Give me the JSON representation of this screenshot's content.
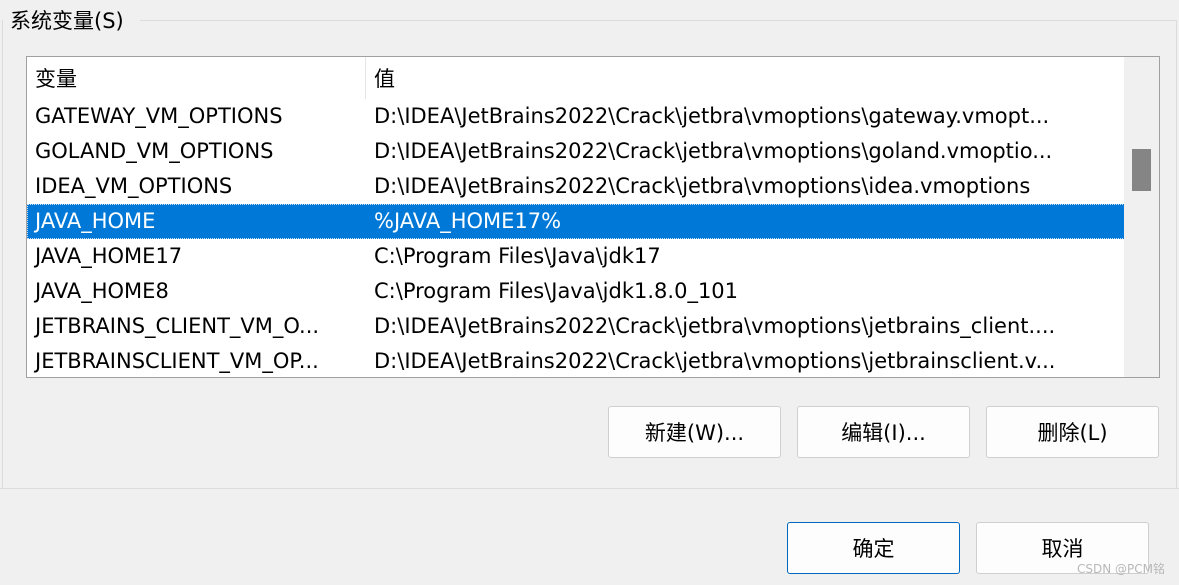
{
  "group": {
    "title": "系统变量(S)"
  },
  "table": {
    "headers": {
      "name": "变量",
      "value": "值"
    },
    "rows": [
      {
        "name": "GATEWAY_VM_OPTIONS",
        "value": "D:\\IDEA\\JetBrains2022\\Crack\\jetbra\\vmoptions\\gateway.vmopt..."
      },
      {
        "name": "GOLAND_VM_OPTIONS",
        "value": "D:\\IDEA\\JetBrains2022\\Crack\\jetbra\\vmoptions\\goland.vmoptio..."
      },
      {
        "name": "IDEA_VM_OPTIONS",
        "value": "D:\\IDEA\\JetBrains2022\\Crack\\jetbra\\vmoptions\\idea.vmoptions"
      },
      {
        "name": "JAVA_HOME",
        "value": "%JAVA_HOME17%"
      },
      {
        "name": "JAVA_HOME17",
        "value": "C:\\Program Files\\Java\\jdk17"
      },
      {
        "name": "JAVA_HOME8",
        "value": "C:\\Program Files\\Java\\jdk1.8.0_101"
      },
      {
        "name": "JETBRAINS_CLIENT_VM_O...",
        "value": "D:\\IDEA\\JetBrains2022\\Crack\\jetbra\\vmoptions\\jetbrains_client...."
      },
      {
        "name": "JETBRAINSCLIENT_VM_OP...",
        "value": "D:\\IDEA\\JetBrains2022\\Crack\\jetbra\\vmoptions\\jetbrainsclient.v..."
      }
    ],
    "selected_row": "JAVA_HOME"
  },
  "buttons": {
    "new": "新建(W)...",
    "edit": "编辑(I)...",
    "delete": "删除(L)",
    "ok": "确定",
    "cancel": "取消"
  },
  "watermark": "CSDN @PCM铭",
  "colors": {
    "selection": "#0078d7",
    "primary_border": "#0067c0"
  }
}
